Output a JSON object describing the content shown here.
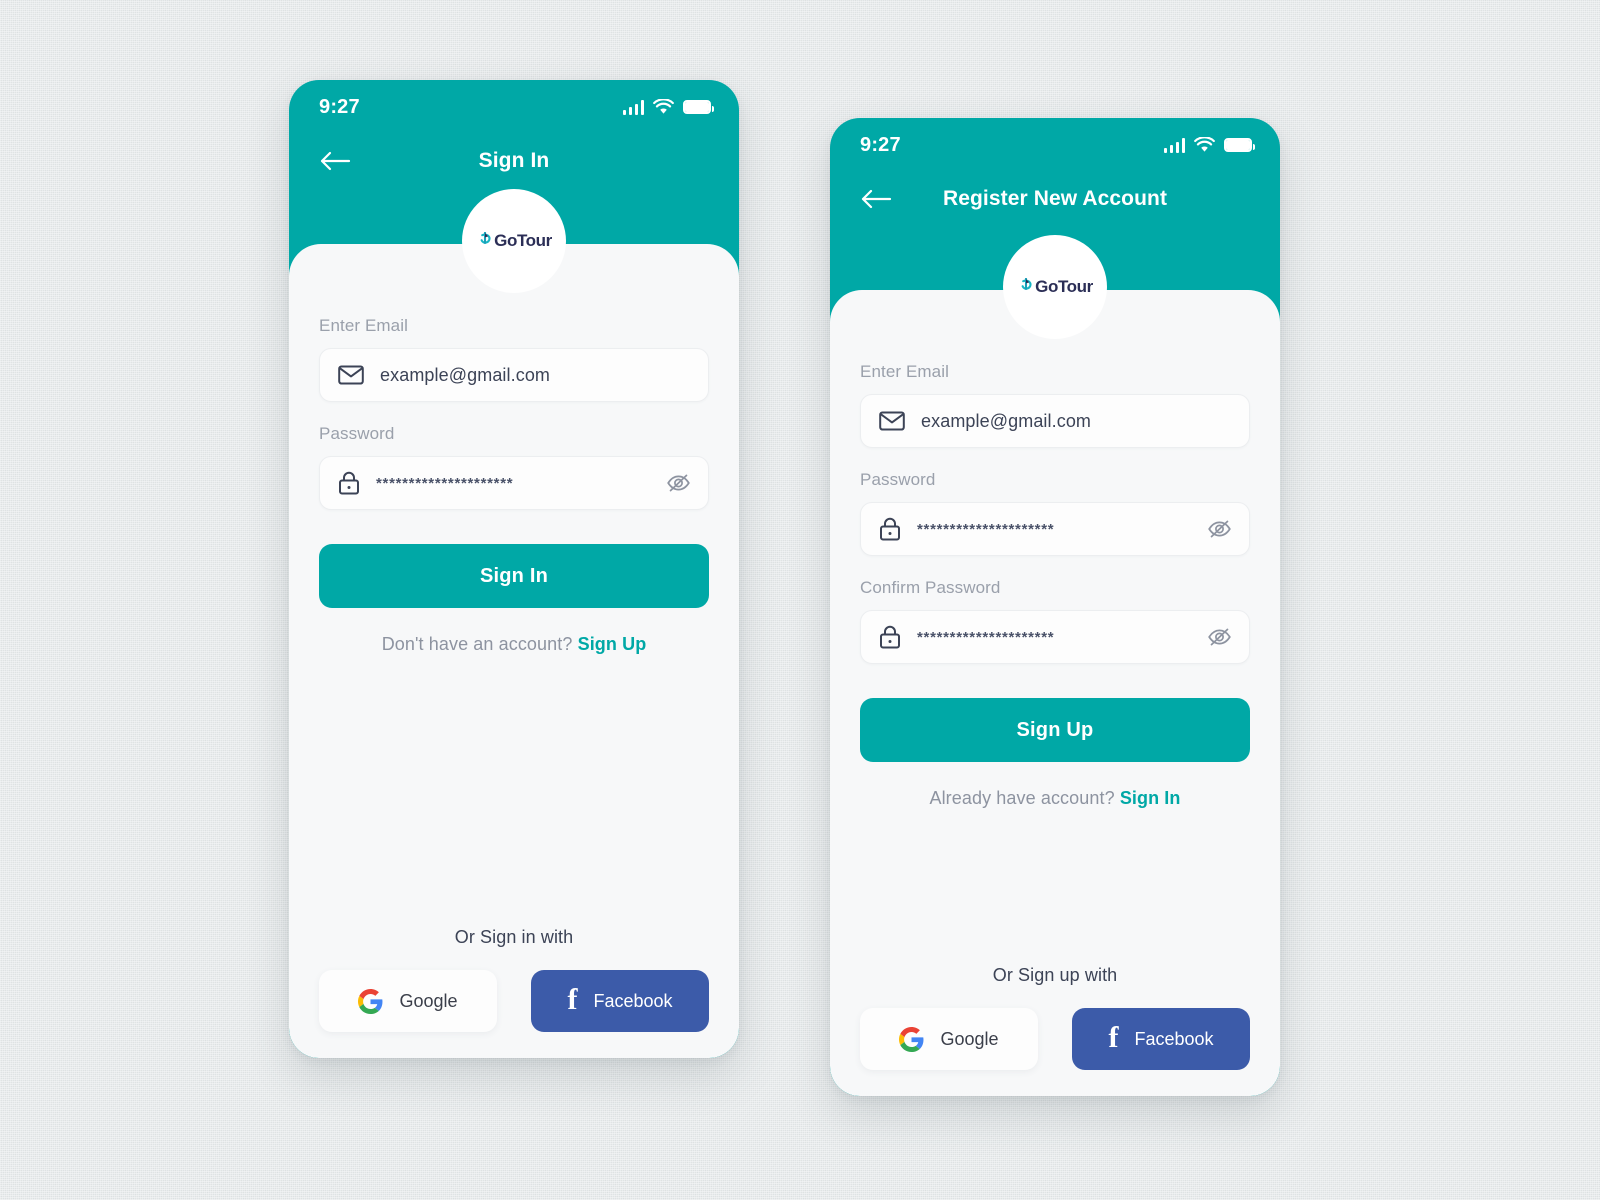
{
  "canvas": {
    "background_color": "#e6eaeb"
  },
  "brand": {
    "name": "GoTour",
    "teal": "#00A8A6",
    "navy": "#2b2e56",
    "facebook_blue": "#3C5BA9",
    "logo_icon": "location-pin-icon"
  },
  "screens": [
    {
      "id": "sign-in",
      "status_bar": {
        "time": "9:27",
        "icons": [
          "signal-icon",
          "wifi-icon",
          "battery-icon"
        ]
      },
      "nav": {
        "back_icon": "arrow-left-icon",
        "title": "Sign In"
      },
      "logo": {
        "text": "GoTour"
      },
      "fields": [
        {
          "key": "email",
          "label": "Enter Email",
          "icon": "envelope-icon",
          "value": "example@gmail.com",
          "placeholder": "example@gmail.com",
          "masked": false,
          "has_toggle": false
        },
        {
          "key": "password",
          "label": "Password",
          "icon": "lock-icon",
          "value": "*********************",
          "placeholder": "Password",
          "masked": true,
          "has_toggle": true,
          "toggle_icon": "eye-off-icon"
        }
      ],
      "primary_button": "Sign In",
      "switch": {
        "prompt": "Don't have an account?",
        "link": "Sign Up"
      },
      "social": {
        "caption": "Or Sign in with",
        "google_label": "Google",
        "google_icon": "google-icon",
        "facebook_label": "Facebook",
        "facebook_icon": "facebook-icon"
      }
    },
    {
      "id": "register",
      "status_bar": {
        "time": "9:27",
        "icons": [
          "signal-icon",
          "wifi-icon",
          "battery-icon"
        ]
      },
      "nav": {
        "back_icon": "arrow-left-icon",
        "title": "Register New Account"
      },
      "logo": {
        "text": "GoTour"
      },
      "fields": [
        {
          "key": "email",
          "label": "Enter Email",
          "icon": "envelope-icon",
          "value": "example@gmail.com",
          "placeholder": "example@gmail.com",
          "masked": false,
          "has_toggle": false
        },
        {
          "key": "password",
          "label": "Password",
          "icon": "lock-icon",
          "value": "*********************",
          "placeholder": "Password",
          "masked": true,
          "has_toggle": true,
          "toggle_icon": "eye-off-icon"
        },
        {
          "key": "confirm_password",
          "label": "Confirm Password",
          "icon": "lock-icon",
          "value": "*********************",
          "placeholder": "Confirm Password",
          "masked": true,
          "has_toggle": true,
          "toggle_icon": "eye-off-icon"
        }
      ],
      "primary_button": "Sign Up",
      "switch": {
        "prompt": "Already have account?",
        "link": "Sign In"
      },
      "social": {
        "caption": "Or Sign up with",
        "google_label": "Google",
        "google_icon": "google-icon",
        "facebook_label": "Facebook",
        "facebook_icon": "facebook-icon"
      }
    }
  ]
}
